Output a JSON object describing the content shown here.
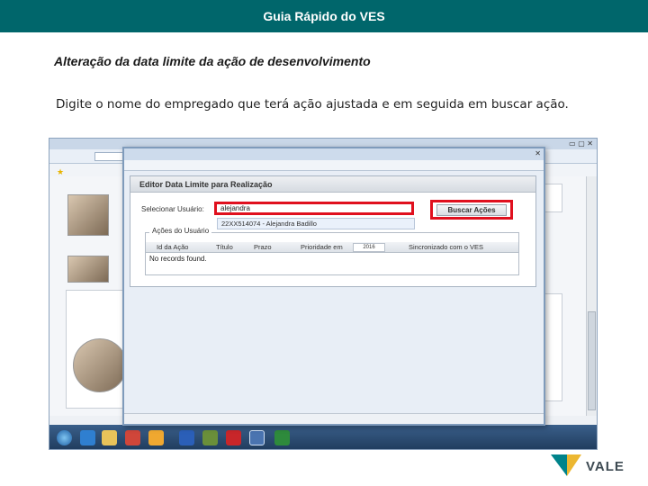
{
  "header": {
    "title": "Guia Rápido do VES"
  },
  "section": {
    "subtitle": "Alteração da data limite da ação de desenvolvimento",
    "description": "Digite o nome do empregado que terá ação ajustada e em seguida em buscar ação."
  },
  "popup": {
    "heading": "Editor Data Limite para Realização",
    "user_label": "Selecionar Usuário:",
    "user_value": "alejandra",
    "suggestion": "22XX514074 - Alejandra Badillo",
    "search_button": "Buscar Ações",
    "group_legend": "Ações do Usuário",
    "columns": [
      "Id da Ação",
      "Título",
      "Prazo",
      "Prioridade em",
      "Sincronizado com o VES"
    ],
    "date_filter": "2016",
    "empty_message": "No records found."
  },
  "brand": {
    "logo_text": "VALE"
  },
  "colors": {
    "header_bg": "#00666b",
    "highlight": "#e0101e",
    "logo_green": "#00838a",
    "logo_yellow": "#ecb731"
  }
}
